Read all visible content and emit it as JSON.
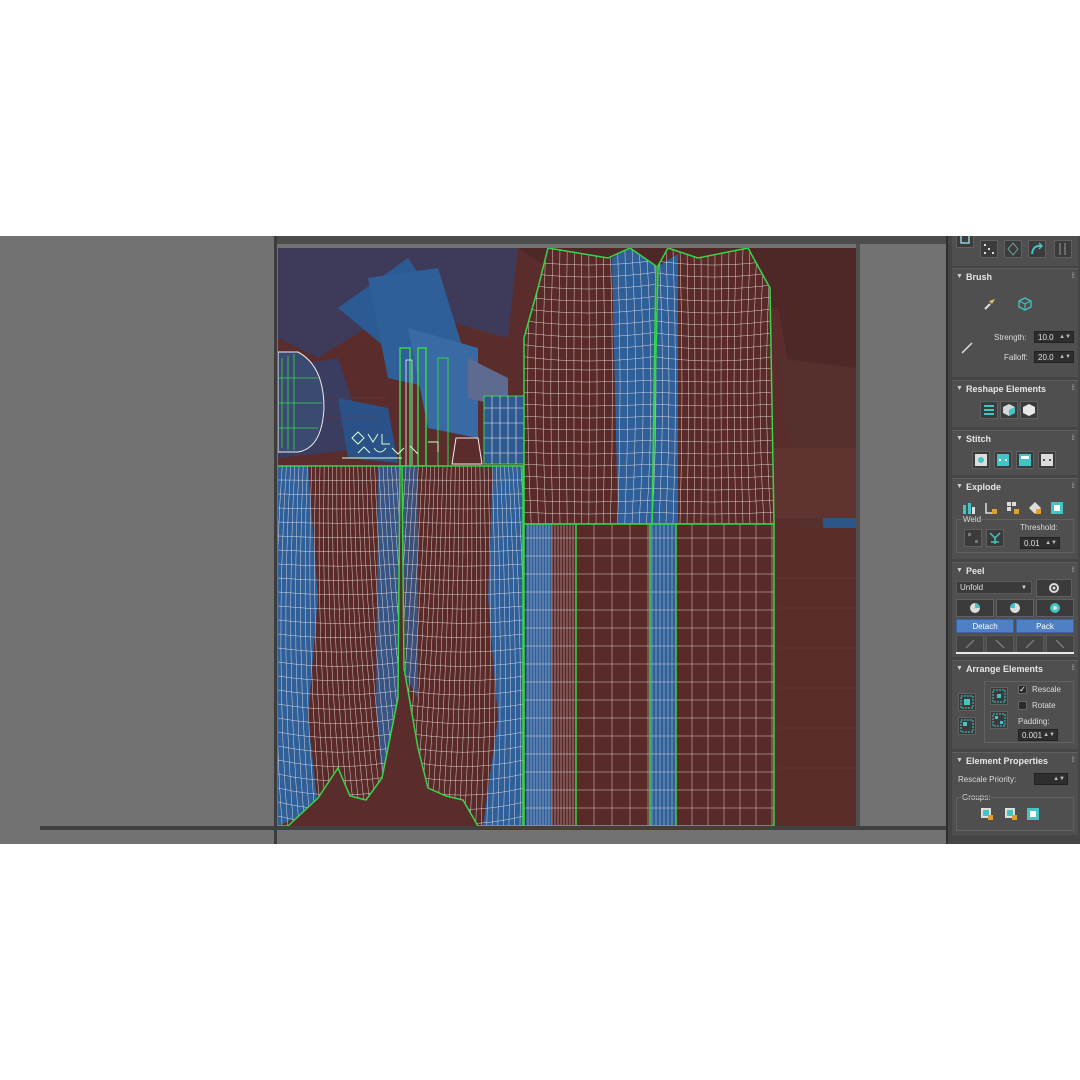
{
  "panel": {
    "brush": {
      "title": "Brush",
      "strength_label": "Strength:",
      "strength_value": "10.0",
      "falloff_label": "Falloff:",
      "falloff_value": "20.0"
    },
    "reshape": {
      "title": "Reshape Elements"
    },
    "stitch": {
      "title": "Stitch"
    },
    "explode": {
      "title": "Explode",
      "weld_label": "Weld",
      "threshold_label": "Threshold:",
      "threshold_value": "0.01"
    },
    "peel": {
      "title": "Peel",
      "dropdown_value": "Unfold",
      "detach_label": "Detach",
      "pack_label": "Pack"
    },
    "arrange": {
      "title": "Arrange Elements",
      "rescale_label": "Rescale",
      "rescale_checked": true,
      "rotate_label": "Rotate",
      "rotate_checked": false,
      "padding_label": "Padding:",
      "padding_value": "0.001"
    },
    "element_properties": {
      "title": "Element Properties",
      "rescale_priority_label": "Rescale Priority:",
      "groups_label": "Groups:"
    }
  },
  "icons": [
    "collapse-triangle-icon",
    "paint-brush-icon",
    "relax-cube-icon",
    "line-brush-icon",
    "stitch-icon",
    "explode-icon",
    "weld-icon",
    "peel-icon",
    "pack-icon",
    "settings-gear-icon",
    "group-icon"
  ],
  "colors": {
    "panel_bg": "#4f4f4f",
    "viewport_bg": "#727272",
    "uv_edge_white": "#f2eaea",
    "uv_seam_green": "#35d64a",
    "texture_red": "#5a2a28",
    "texture_blue": "#2f5f99",
    "highlight_blue": "#4f80c6"
  }
}
